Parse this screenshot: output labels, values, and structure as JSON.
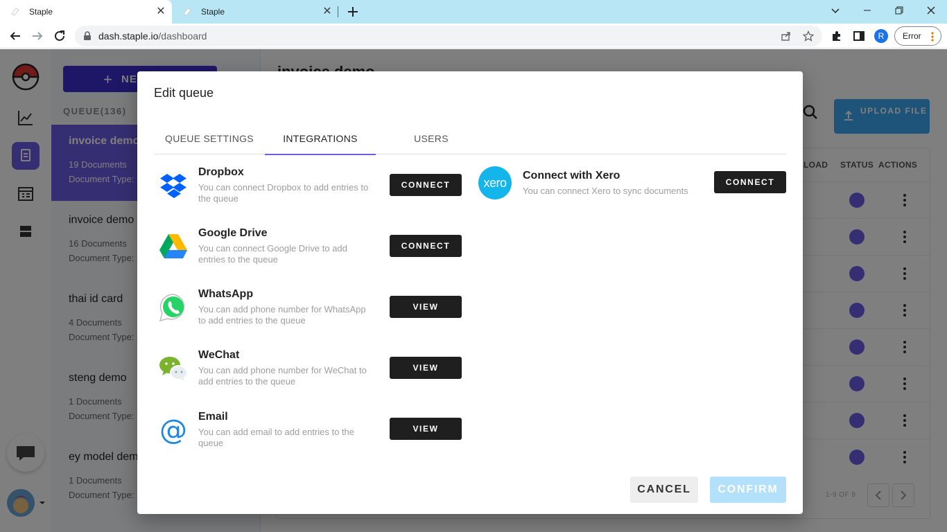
{
  "browser": {
    "tabs": [
      {
        "title": "Staple",
        "active": true
      },
      {
        "title": "Staple",
        "active": false
      }
    ],
    "url_host": "dash.staple.io",
    "url_path": "/dashboard",
    "profile_initial": "R",
    "error_label": "Error"
  },
  "sidebar": {
    "new_button": "NEW",
    "queue_count": "QUEUE(136)",
    "queues": [
      {
        "name": "invoice demo",
        "docs": "19 Documents",
        "type": "Document Type:"
      },
      {
        "name": "invoice demo",
        "docs": "16 Documents",
        "type": "Document Type:"
      },
      {
        "name": "thai id card",
        "docs": "4 Documents",
        "type": "Document Type:"
      },
      {
        "name": "steng demo",
        "docs": "1 Documents",
        "type": "Document Type:"
      },
      {
        "name": "ey model dem",
        "docs": "1 Documents",
        "type": "Document Type:"
      }
    ]
  },
  "main": {
    "title": "invoice demo",
    "upload_label": "UPLOAD FILE",
    "columns": {
      "load": "LOAD",
      "status": "STATUS",
      "actions": "ACTIONS"
    },
    "pagination": "1-9 OF 9"
  },
  "modal": {
    "title": "Edit queue",
    "tabs": [
      "QUEUE SETTINGS",
      "INTEGRATIONS",
      "USERS"
    ],
    "active_tab": "INTEGRATIONS",
    "integrations": [
      {
        "name": "Dropbox",
        "desc": "You can connect Dropbox to add entries to the queue",
        "button": "CONNECT",
        "icon": "dropbox-icon"
      },
      {
        "name": "Google Drive",
        "desc": "You can connect Google Drive to add entries to the queue",
        "button": "CONNECT",
        "icon": "google-drive-icon"
      },
      {
        "name": "WhatsApp",
        "desc": "You can add phone number for WhatsApp to add entries to the queue",
        "button": "VIEW",
        "icon": "whatsapp-icon"
      },
      {
        "name": "WeChat",
        "desc": "You can add phone number for WeChat to add entries to the queue",
        "button": "VIEW",
        "icon": "wechat-icon"
      },
      {
        "name": "Email",
        "desc": "You can add email to add entries to the queue",
        "button": "VIEW",
        "icon": "email-at-icon"
      }
    ],
    "xero": {
      "name": "Connect with Xero",
      "desc": "You can connect Xero to sync documents",
      "button": "CONNECT",
      "logo_text": "xero"
    },
    "cancel_label": "CANCEL",
    "confirm_label": "CONFIRM"
  },
  "colors": {
    "accent": "#6c5ce7",
    "tab_underline": "#6c5ce7",
    "dark_button": "#1f1f1f",
    "confirm_disabled": "#b3e0fa",
    "xero_blue": "#13b5ea"
  }
}
